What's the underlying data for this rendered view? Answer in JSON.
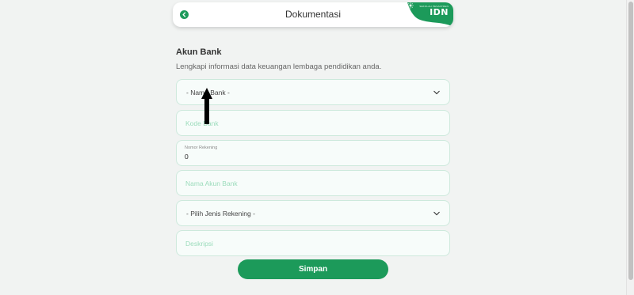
{
  "header": {
    "title": "Dokumentasi",
    "brand_text": "IDN",
    "brand_subtext": "SEKOLAH PESANTREN"
  },
  "section": {
    "title": "Akun Bank",
    "description": "Lengkapi informasi data keuangan lembaga pendidikan anda."
  },
  "form": {
    "bank_name_select": "- Nama Bank -",
    "bank_code_placeholder": "Kode Bank",
    "account_number_label": "Nomor Rekening",
    "account_number_value": "0",
    "account_name_placeholder": "Nama Akun Bank",
    "account_type_select": "- Pilih Jenis Rekening -",
    "description_placeholder": "Deskripsi"
  },
  "actions": {
    "save_label": "Simpan"
  },
  "colors": {
    "accent": "#1c9a5a",
    "field_bg": "#f7fcfa",
    "field_border": "#cde9dc",
    "placeholder": "#9cdcbc"
  }
}
